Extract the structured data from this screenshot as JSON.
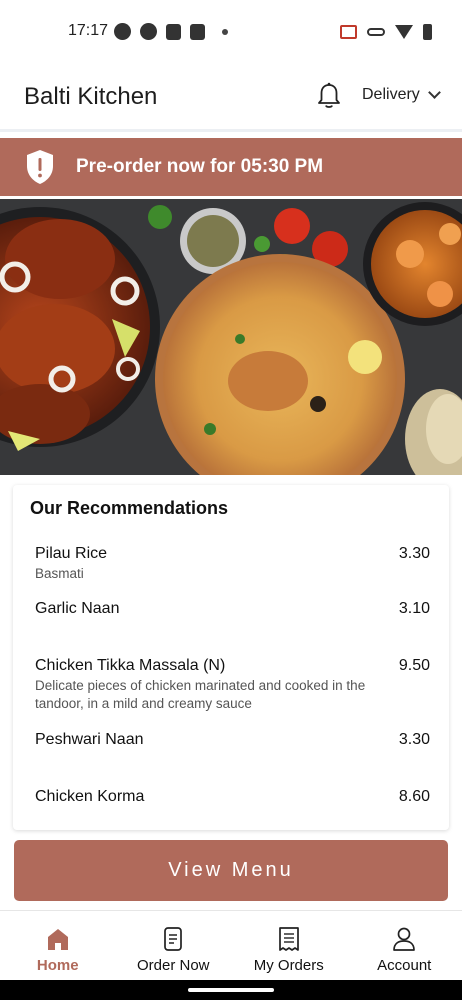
{
  "status_bar": {
    "time": "17:17"
  },
  "header": {
    "title": "Balti Kitchen",
    "delivery_mode": "Delivery"
  },
  "banner": {
    "text": "Pre-order now for 05:30 PM"
  },
  "recommendations": {
    "title": "Our Recommendations",
    "items": [
      {
        "name": "Pilau Rice",
        "price": "3.30",
        "desc": "Basmati"
      },
      {
        "name": "Garlic Naan",
        "price": "3.10",
        "desc": ""
      },
      {
        "name": "Chicken Tikka Massala (N)",
        "price": "9.50",
        "desc": "Delicate pieces of chicken marinated and cooked in the tandoor, in a mild and creamy sauce"
      },
      {
        "name": "Peshwari Naan",
        "price": "3.30",
        "desc": ""
      },
      {
        "name": "Chicken Korma",
        "price": "8.60",
        "desc": ""
      }
    ]
  },
  "view_menu_label": "View Menu",
  "bottom_nav": {
    "items": [
      {
        "label": "Home",
        "icon": "home-icon",
        "active": true
      },
      {
        "label": "Order Now",
        "icon": "order-icon",
        "active": false
      },
      {
        "label": "My Orders",
        "icon": "receipt-icon",
        "active": false
      },
      {
        "label": "Account",
        "icon": "user-icon",
        "active": false
      }
    ]
  },
  "colors": {
    "accent": "#b06a5b"
  }
}
